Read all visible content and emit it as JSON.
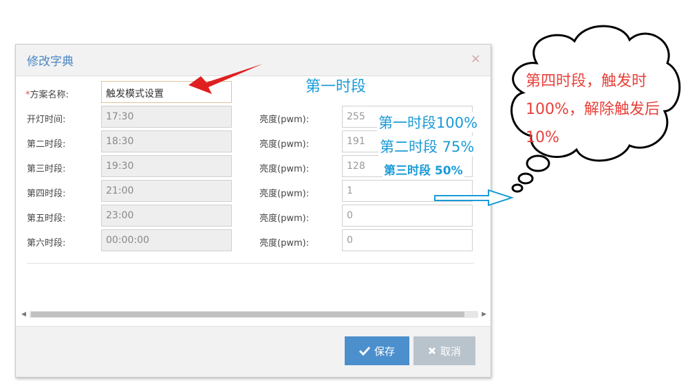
{
  "dialog": {
    "title": "修改字典",
    "close_glyph": "×",
    "scheme_label_required": "*",
    "scheme_label": "方案名称:",
    "scheme_value": "触发模式设置",
    "rows": [
      {
        "label": "开灯时间:",
        "time": "17:30",
        "brightness_label": "亮度(pwm):",
        "brightness": "255"
      },
      {
        "label": "第二时段:",
        "time": "18:30",
        "brightness_label": "亮度(pwm):",
        "brightness": "191"
      },
      {
        "label": "第三时段:",
        "time": "19:30",
        "brightness_label": "亮度(pwm):",
        "brightness": "128"
      },
      {
        "label": "第四时段:",
        "time": "21:00",
        "brightness_label": "亮度(pwm):",
        "brightness": "1"
      },
      {
        "label": "第五时段:",
        "time": "23:00",
        "brightness_label": "亮度(pwm):",
        "brightness": "0"
      },
      {
        "label": "第六时段:",
        "time": "00:00:00",
        "brightness_label": "亮度(pwm):",
        "brightness": "0"
      }
    ],
    "save_label": "保存",
    "cancel_label": "取消"
  },
  "annotations": {
    "heading": "第一时段",
    "line1": "第一时段100%",
    "line2": "第二时段 75%",
    "line3": "第三时段 50%",
    "cloud": "第四时段，触发时100%，解除触发后10%"
  },
  "colors": {
    "accent": "#4a87c5",
    "annotation_blue": "#1a9bd7",
    "annotation_red": "#e8403a",
    "arrow_red": "#e02020",
    "save_button": "#4b8fcd",
    "cancel_button": "#b9c3cc"
  },
  "icons": {
    "save": "check-icon",
    "cancel": "x-icon",
    "close": "close-icon"
  }
}
